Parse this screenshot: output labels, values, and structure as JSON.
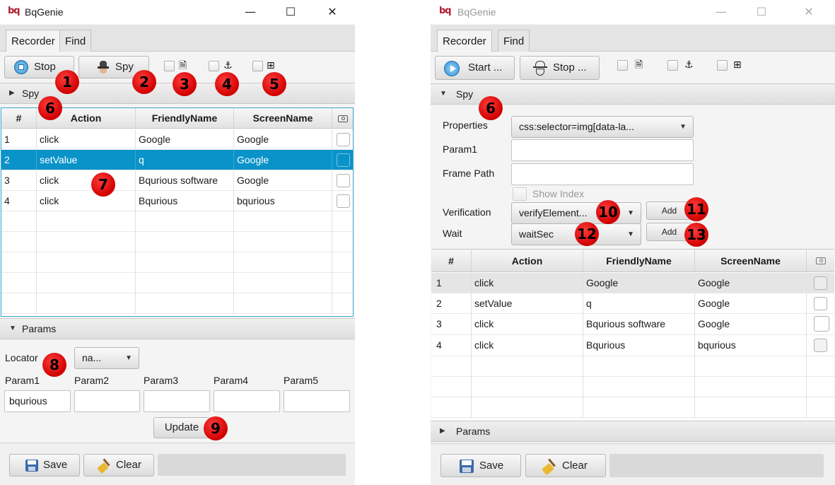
{
  "left_window": {
    "logo": "bq",
    "title": "BqGenie",
    "window_controls": {
      "minimize": "—",
      "maximize": "☐",
      "close": "✕"
    },
    "tabs": [
      {
        "label": "Recorder",
        "active": true
      },
      {
        "label": "Find",
        "active": false
      }
    ],
    "toolbar": {
      "stop_label": "Stop",
      "spy_label": "Spy",
      "toggles": [
        {
          "icon": "page-icon",
          "glyph": "🗎"
        },
        {
          "icon": "anchor-icon",
          "glyph": "⚓"
        },
        {
          "icon": "table-icon",
          "glyph": "⊞"
        }
      ]
    },
    "spy_section": {
      "label": "Spy",
      "expanded": false
    },
    "table": {
      "headers": [
        "#",
        "Action",
        "FriendlyName",
        "ScreenName"
      ],
      "camera_icon": "camera-icon",
      "rows": [
        {
          "num": "1",
          "action": "click",
          "friendly": "Google",
          "screen": "Google"
        },
        {
          "num": "2",
          "action": "setValue",
          "friendly": "q",
          "screen": "Google",
          "selected": true
        },
        {
          "num": "3",
          "action": "click",
          "friendly": "Bqurious software",
          "screen": "Google"
        },
        {
          "num": "4",
          "action": "click",
          "friendly": "Bqurious",
          "screen": "bqurious"
        }
      ]
    },
    "params_section": {
      "label": "Params",
      "expanded": true,
      "locator_label": "Locator",
      "locator_value": "na...",
      "param_labels": [
        "Param1",
        "Param2",
        "Param3",
        "Param4",
        "Param5"
      ],
      "param_values": [
        "bqurious",
        "",
        "",
        "",
        ""
      ],
      "update_label": "Update"
    },
    "footer": {
      "save_label": "Save",
      "clear_label": "Clear"
    },
    "badges": [
      "1",
      "2",
      "3",
      "4",
      "5",
      "6",
      "7",
      "8",
      "9"
    ]
  },
  "right_window": {
    "logo": "bq",
    "title": "BqGenie",
    "window_controls": {
      "minimize": "—",
      "maximize": "☐",
      "close": "✕"
    },
    "tabs": [
      {
        "label": "Recorder",
        "active": true
      },
      {
        "label": "Find",
        "active": false
      }
    ],
    "toolbar": {
      "start_label": "Start ...",
      "stop_label": "Stop ...",
      "toggles": [
        {
          "icon": "page-icon",
          "glyph": "🗎"
        },
        {
          "icon": "anchor-icon",
          "glyph": "⚓"
        },
        {
          "icon": "table-icon",
          "glyph": "⊞"
        }
      ]
    },
    "spy_section": {
      "label": "Spy",
      "expanded": true,
      "properties_label": "Properties",
      "properties_value": "css:selector=img[data-la...",
      "param1_label": "Param1",
      "frame_path_label": "Frame Path",
      "show_index_label": "Show Index",
      "verification_label": "Verification",
      "verification_value": "verifyElement...",
      "wait_label": "Wait",
      "wait_value": "waitSec",
      "add_label": "Add"
    },
    "table": {
      "headers": [
        "#",
        "Action",
        "FriendlyName",
        "ScreenName"
      ],
      "camera_icon": "camera-icon",
      "rows": [
        {
          "num": "1",
          "action": "click",
          "friendly": "Google",
          "screen": "Google",
          "highlighted": true
        },
        {
          "num": "2",
          "action": "setValue",
          "friendly": "q",
          "screen": "Google"
        },
        {
          "num": "3",
          "action": "click",
          "friendly": "Bqurious software",
          "screen": "Google"
        },
        {
          "num": "4",
          "action": "click",
          "friendly": "Bqurious",
          "screen": "bqurious"
        }
      ]
    },
    "params_section": {
      "label": "Params",
      "expanded": false
    },
    "footer": {
      "save_label": "Save",
      "clear_label": "Clear"
    },
    "badges": [
      "6",
      "10",
      "11",
      "12",
      "13"
    ]
  },
  "colors": {
    "selection": "#0a93c8",
    "badge": "#e00000",
    "brand": "#b01c2e",
    "focus_border": "#3aa8d2"
  }
}
